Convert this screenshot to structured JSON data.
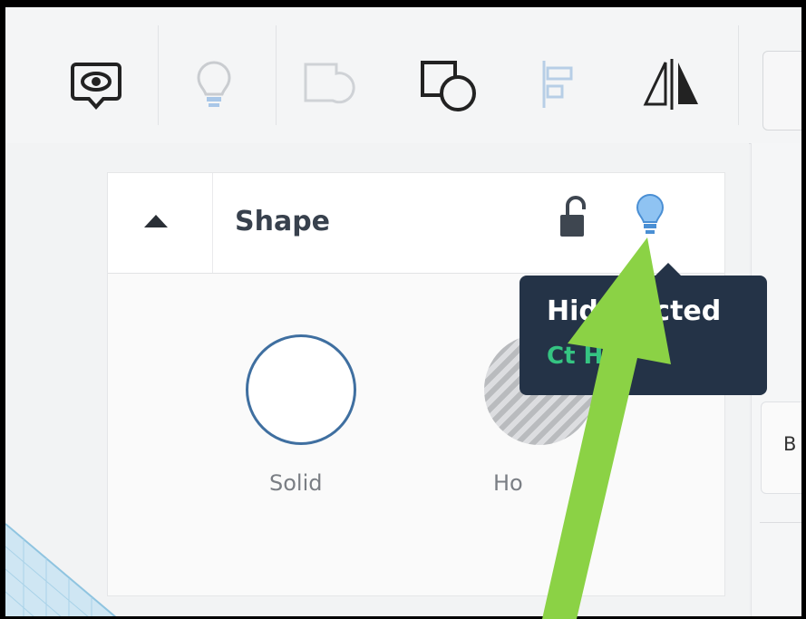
{
  "panel": {
    "title": "Shape",
    "options": [
      {
        "label": "Solid"
      },
      {
        "label": "Ho"
      }
    ]
  },
  "tooltip": {
    "title": "Hid  elected",
    "shortcut": "Ct   H"
  },
  "right_panel": {
    "partial_text": "B"
  },
  "colors": {
    "annotation_arrow": "#8bd245",
    "tooltip_bg": "#243347",
    "shortcut_text": "#35c482",
    "bulb_active": "#8fc3f2"
  }
}
